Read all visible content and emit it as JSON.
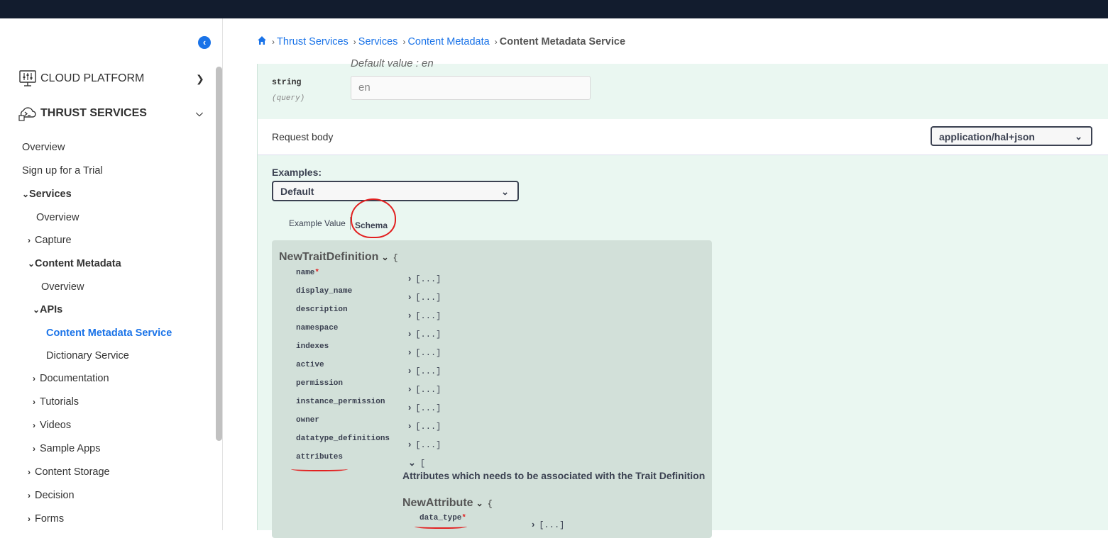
{
  "sidebar": {
    "sections": [
      {
        "label": "CLOUD PLATFORM",
        "icon": "monitor-sliders-icon",
        "expanded": false
      },
      {
        "label": "THRUST SERVICES",
        "icon": "cloud-terminal-icon",
        "expanded": true
      }
    ],
    "items": {
      "overview": "Overview",
      "trial": "Sign up for a Trial",
      "services": "Services",
      "services_overview": "Overview",
      "capture": "Capture",
      "content_metadata": "Content Metadata",
      "cm_overview": "Overview",
      "apis": "APIs",
      "cm_service": "Content Metadata Service",
      "dictionary_service": "Dictionary Service",
      "documentation": "Documentation",
      "tutorials": "Tutorials",
      "videos": "Videos",
      "sample_apps": "Sample Apps",
      "content_storage": "Content Storage",
      "decision": "Decision",
      "forms": "Forms"
    }
  },
  "breadcrumb": {
    "items": [
      "Thrust Services",
      "Services",
      "Content Metadata"
    ],
    "current": "Content Metadata Service"
  },
  "parameter": {
    "type": "string",
    "in": "(query)",
    "default_text": "Default value : en",
    "value": "en"
  },
  "request_body": {
    "label": "Request body",
    "content_type": "application/hal+json"
  },
  "examples": {
    "label": "Examples:",
    "selected": "Default"
  },
  "tabs": {
    "example_value": "Example Value",
    "schema": "Schema"
  },
  "schema": {
    "model": "NewTraitDefinition",
    "open_brace": "{",
    "collapsed": "[...]",
    "open_bracket": "[",
    "properties": [
      {
        "name": "name",
        "required": "*"
      },
      {
        "name": "display_name",
        "required": ""
      },
      {
        "name": "description",
        "required": ""
      },
      {
        "name": "namespace",
        "required": ""
      },
      {
        "name": "indexes",
        "required": ""
      },
      {
        "name": "active",
        "required": ""
      },
      {
        "name": "permission",
        "required": ""
      },
      {
        "name": "instance_permission",
        "required": ""
      },
      {
        "name": "owner",
        "required": ""
      },
      {
        "name": "datatype_definitions",
        "required": ""
      },
      {
        "name": "attributes",
        "required": ""
      }
    ],
    "attributes_description": "Attributes which needs to be associated with the Trait Definition",
    "sub_model": "NewAttribute",
    "sub_property": {
      "name": "data_type",
      "required": "*"
    }
  }
}
